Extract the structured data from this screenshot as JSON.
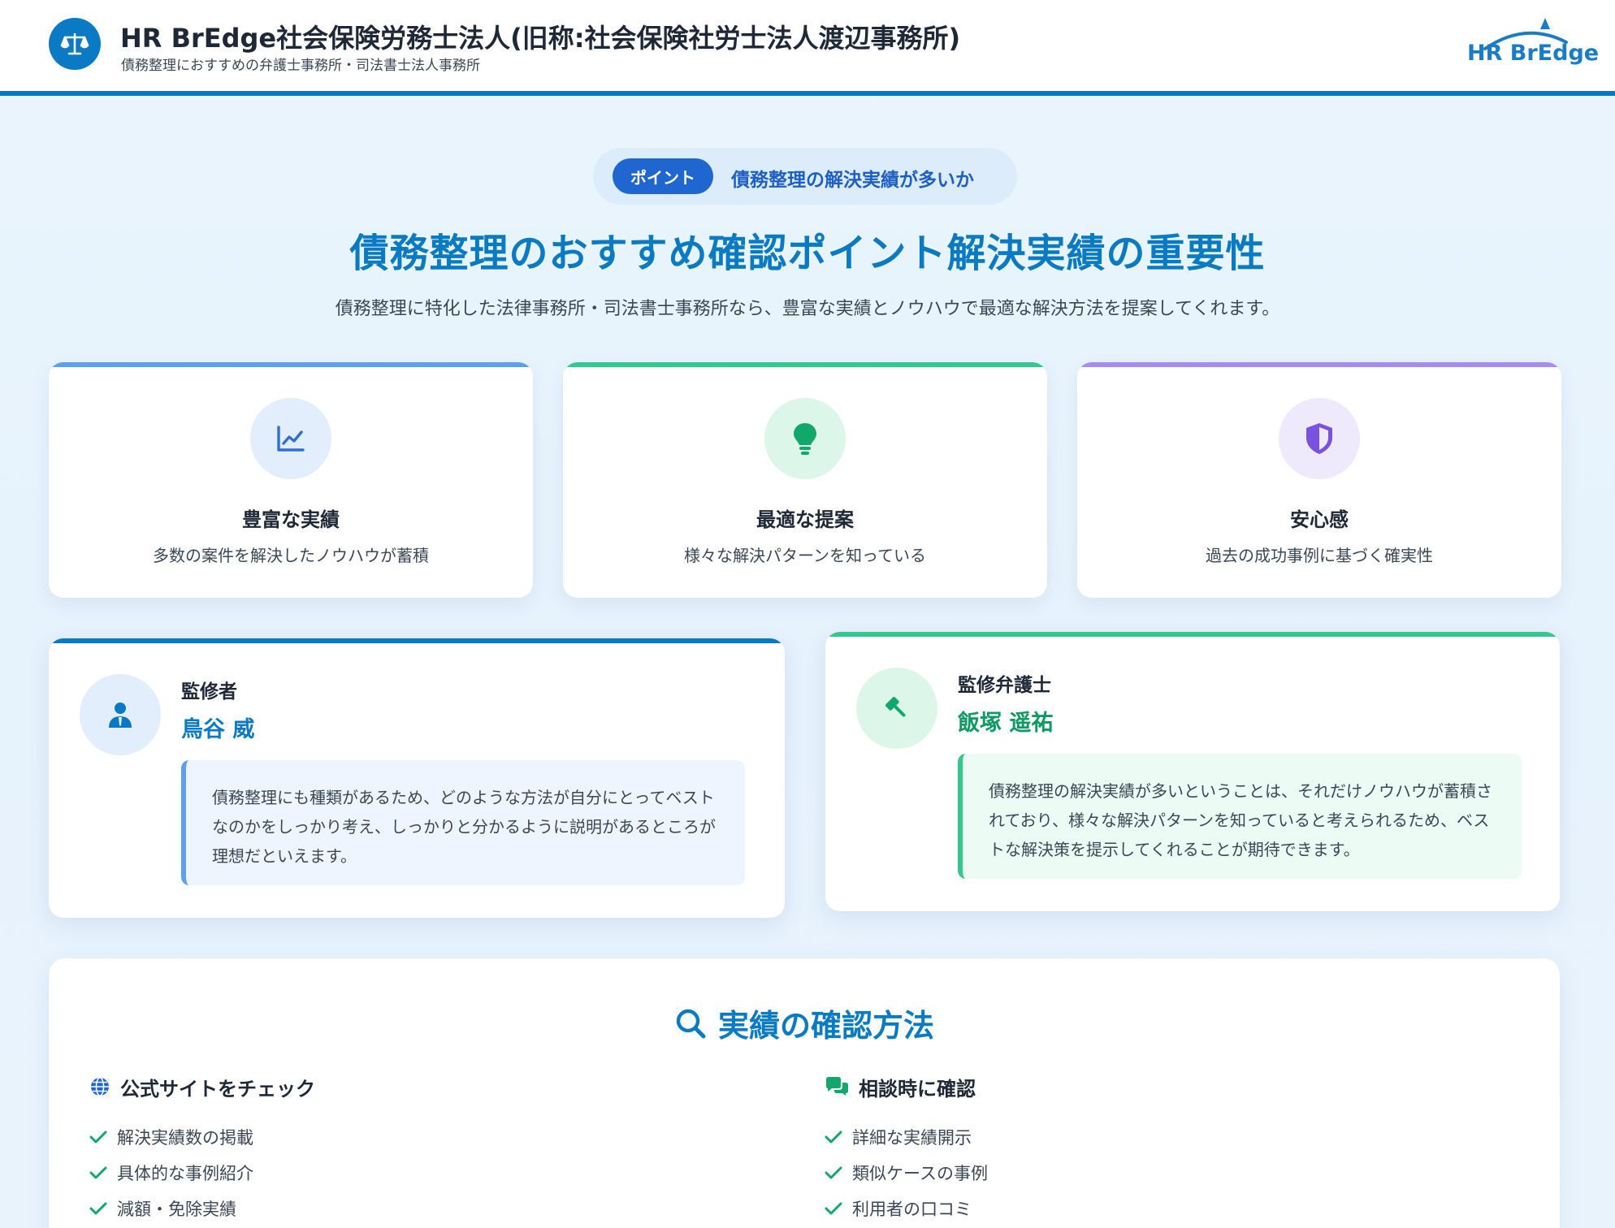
{
  "header": {
    "title": "HR BrEdge社会保険労務士法人(旧称:社会保険社労士法人渡辺事務所)",
    "subtitle": "債務整理におすすめの弁護士事務所・司法書士法人事務所",
    "logo_icon": "scale-icon",
    "brand_logo_text": "HR BrEdge"
  },
  "point": {
    "badge": "ポイント",
    "text": "債務整理の解決実績が多いか"
  },
  "main": {
    "title": "債務整理のおすすめ確認ポイント解決実績の重要性",
    "description": "債務整理に特化した法律事務所・司法書士事務所なら、豊富な実績とノウハウで最適な解決方法を提案してくれます。"
  },
  "features": [
    {
      "icon": "chart-line-icon",
      "title": "豊富な実績",
      "desc": "多数の案件を解決したノウハウが蓄積",
      "accent": "#5f9ff0",
      "icon_bg": "#e3eefc",
      "icon_color": "#2f6fd6"
    },
    {
      "icon": "lightbulb-icon",
      "title": "最適な提案",
      "desc": "様々な解決パターンを知っている",
      "accent": "#34c88f",
      "icon_bg": "#dcf6ea",
      "icon_color": "#13a86b"
    },
    {
      "icon": "shield-icon",
      "title": "安心感",
      "desc": "過去の成功事例に基づく確実性",
      "accent": "#a98cf0",
      "icon_bg": "#efe9fc",
      "icon_color": "#7a52e0"
    }
  ],
  "supervisors": [
    {
      "icon": "user-tie-icon",
      "role": "監修者",
      "name": "鳥谷 威",
      "quote": "債務整理にも種類があるため、どのような方法が自分にとってベストなのかをしっかり考え、しっかりと分かるように説明があるところが理想だといえます。",
      "accent": "#0a78c2",
      "name_color": "#0a78c2",
      "avatar_bg": "#e2eefb",
      "quote_bg": "#eef5fe",
      "quote_border": "#5f9ff0"
    },
    {
      "icon": "gavel-icon",
      "role": "監修弁護士",
      "name": "飯塚 遥祐",
      "quote": "債務整理の解決実績が多いということは、それだけノウハウが蓄積されており、様々な解決パターンを知っていると考えられるため、ベストな解決策を提示してくれることが期待できます。",
      "accent": "#34c88f",
      "name_color": "#0f9a63",
      "avatar_bg": "#dcf6ea",
      "quote_bg": "#ecfbf3",
      "quote_border": "#34c88f"
    }
  ],
  "method": {
    "title": "実績の確認方法",
    "title_icon": "search-icon",
    "columns": [
      {
        "icon": "globe-icon",
        "title": "公式サイトをチェック",
        "items": [
          "解決実績数の掲載",
          "具体的な事例紹介",
          "減額・免除実績"
        ]
      },
      {
        "icon": "chat-bubbles-icon",
        "title": "相談時に確認",
        "items": [
          "詳細な実績開示",
          "類似ケースの事例",
          "利用者の口コミ"
        ]
      }
    ]
  }
}
